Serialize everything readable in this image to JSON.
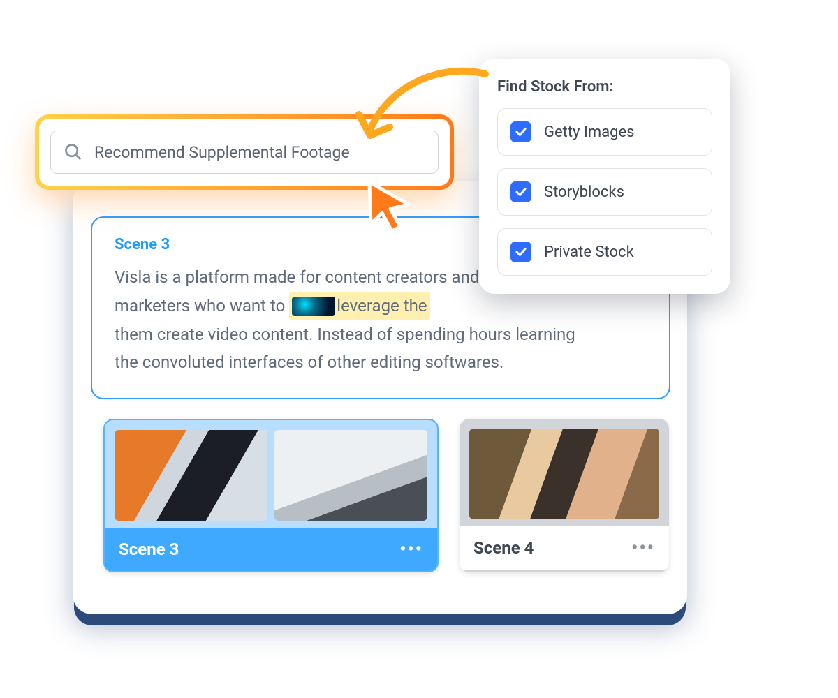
{
  "search": {
    "text": "Recommend Supplemental Footage"
  },
  "popover": {
    "title": "Find Stock From:",
    "options": [
      {
        "label": "Getty Images",
        "checked": true
      },
      {
        "label": "Storyblocks",
        "checked": true
      },
      {
        "label": "Private Stock",
        "checked": true
      }
    ]
  },
  "scene": {
    "title": "Scene 3",
    "line1": "Visla is a platform made for content creators and",
    "line2a": "marketers who want to",
    "line2_highlight": "leverage the",
    "line3": "them create video content. Instead of spending hours learning",
    "line4": "the convoluted interfaces of other editing softwares."
  },
  "cards": [
    {
      "label": "Scene 3"
    },
    {
      "label": "Scene 4"
    }
  ]
}
